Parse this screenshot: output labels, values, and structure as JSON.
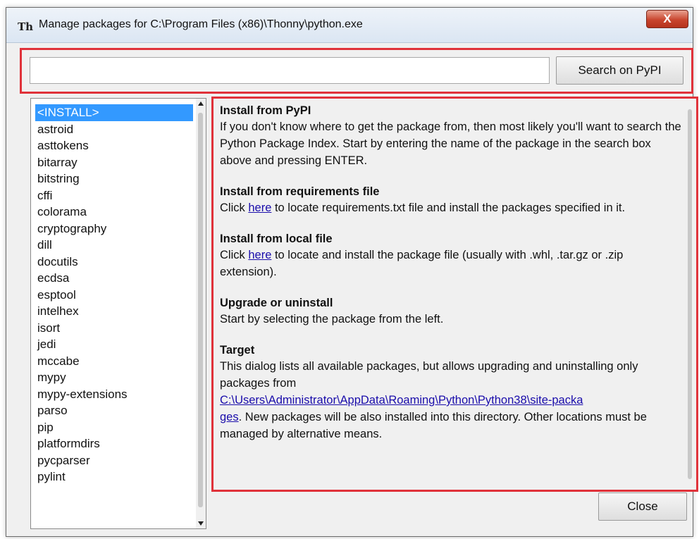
{
  "window": {
    "title": "Manage packages for C:\\Program Files (x86)\\Thonny\\python.exe",
    "close_glyph": "X",
    "app_icon_glyph": "Th"
  },
  "search": {
    "value": "",
    "placeholder": "",
    "button_label": "Search on PyPI"
  },
  "packages": [
    "<INSTALL>",
    "astroid",
    "asttokens",
    "bitarray",
    "bitstring",
    "cffi",
    "colorama",
    "cryptography",
    "dill",
    "docutils",
    "ecdsa",
    "esptool",
    "intelhex",
    "isort",
    "jedi",
    "mccabe",
    "mypy",
    "mypy-extensions",
    "parso",
    "pip",
    "platformdirs",
    "pycparser",
    "pylint"
  ],
  "selected_package": "<INSTALL>",
  "info": {
    "pypi": {
      "title": "Install from PyPI",
      "body": "If you don't know where to get the package from, then most likely you'll want to search the Python Package Index. Start by entering the name of the package in the search box above and pressing ENTER."
    },
    "requirements": {
      "title": "Install from requirements file",
      "prefix": "Click ",
      "link": "here",
      "suffix": " to locate requirements.txt file and install the packages specified in it."
    },
    "local": {
      "title": "Install from local file",
      "prefix": "Click ",
      "link": "here",
      "suffix": " to locate and install the package file (usually with .whl, .tar.gz or .zip extension)."
    },
    "upgrade": {
      "title": "Upgrade or uninstall",
      "body": "Start by selecting the package from the left."
    },
    "target": {
      "title": "Target",
      "prefix": "This dialog lists all available packages, but allows upgrading and uninstalling only packages from ",
      "path_line1": "C:\\Users\\Administrator\\AppData\\Roaming\\Python\\Python38\\site-packa",
      "path_line2": "ges",
      "suffix": ". New packages will be also installed into this directory. Other locations must be managed by alternative means."
    }
  },
  "footer": {
    "close_label": "Close"
  },
  "colors": {
    "selection": "#3399ff",
    "annotation_frame": "#e0323a",
    "link": "#1a0dab"
  }
}
